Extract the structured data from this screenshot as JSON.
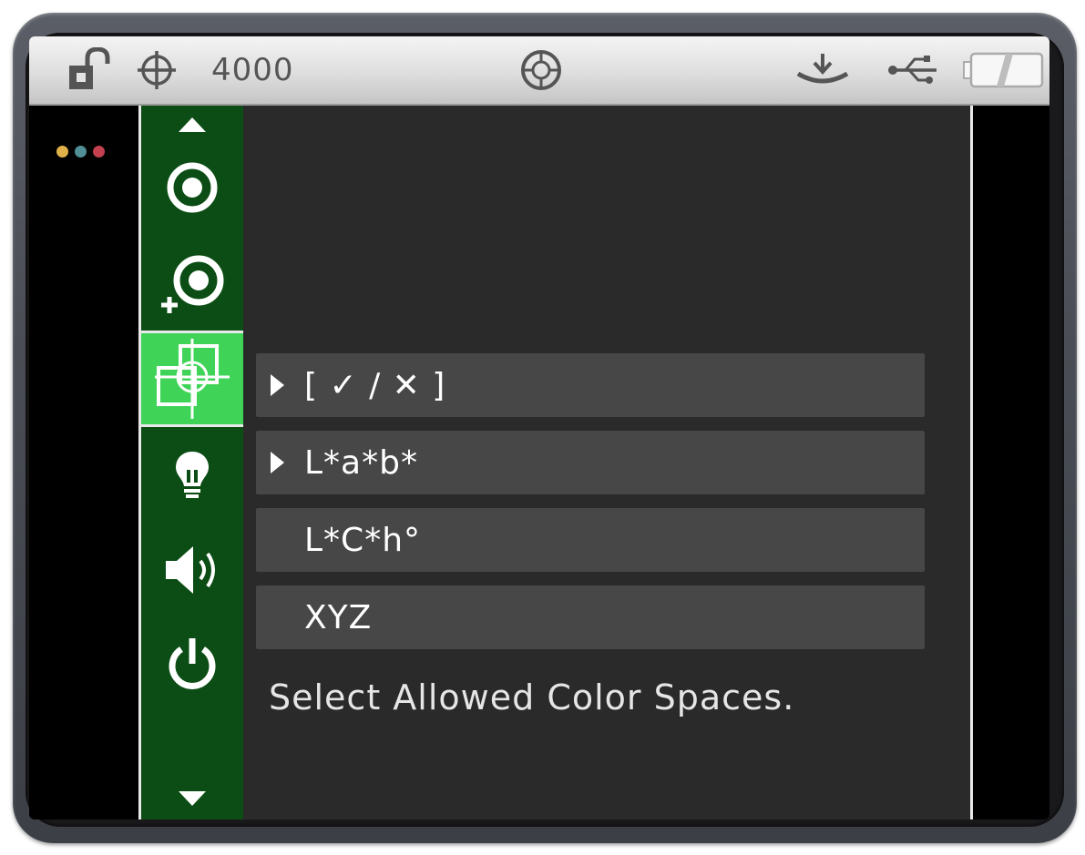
{
  "status_bar": {
    "lock_icon": "unlocked-padlock-icon",
    "target_icon": "crosshair-icon",
    "measurement_count": "4000",
    "center_icon": "aperture-target-icon",
    "dock_icon": "dock-station-icon",
    "usb_icon": "usb-icon",
    "battery_icon": "battery-icon"
  },
  "indicator_dots": {
    "colors": [
      "#e0b04a",
      "#4f8f95",
      "#c2404f"
    ]
  },
  "side_menu": {
    "items": [
      {
        "icon": "up-arrow-icon"
      },
      {
        "icon": "measure-target-icon"
      },
      {
        "icon": "add-target-icon"
      },
      {
        "icon": "color-space-overlap-icon",
        "selected": true
      },
      {
        "icon": "lightbulb-icon"
      },
      {
        "icon": "speaker-icon"
      },
      {
        "icon": "power-icon"
      },
      {
        "icon": "down-arrow-icon"
      }
    ],
    "colors": {
      "background": "#0b4d14",
      "selected": "#3fd457"
    }
  },
  "panel": {
    "options": [
      {
        "label": "[ ✓ / ✕ ]",
        "arrow": true
      },
      {
        "label": "L*a*b*",
        "arrow": true
      },
      {
        "label": "L*C*h°",
        "arrow": false
      },
      {
        "label": "XYZ",
        "arrow": false
      }
    ],
    "help_text": "Select Allowed Color Spaces."
  }
}
